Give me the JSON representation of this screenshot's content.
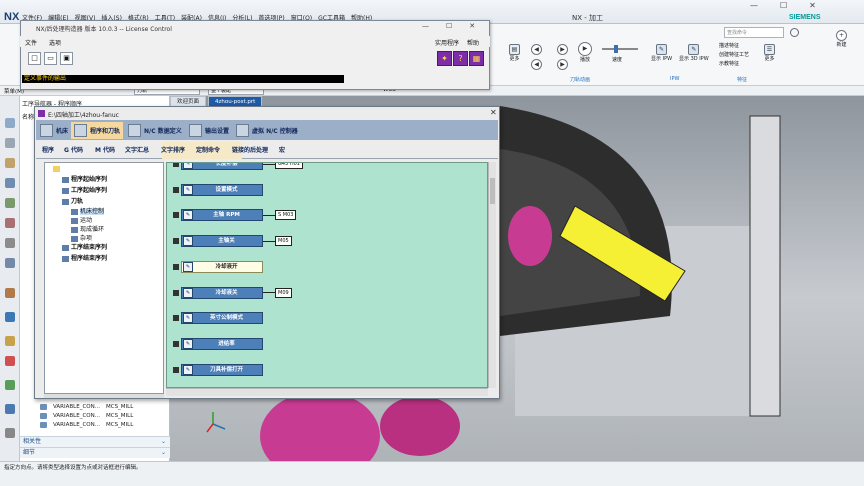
{
  "app": {
    "logo": "NX",
    "window_title": "NX - 加工",
    "brand": "SIEMENS",
    "menu": [
      "文件(F)",
      "编辑(E)",
      "视图(V)",
      "插入(S)",
      "格式(R)",
      "工具(T)",
      "装配(A)",
      "信息(I)",
      "分析(L)",
      "首选项(P)",
      "窗口(O)",
      "GC工具箱",
      "帮助(H)"
    ],
    "search_placeholder": "查找命令",
    "ribbon_groups": {
      "toolpath_anim": "刀轨动画",
      "ipw": "IPW",
      "features": "特征"
    },
    "ribbon_buttons": {
      "more1": "更多",
      "play": "播放",
      "speed": "速度",
      "show_ipw": "显示 IPW",
      "show_3d_ipw": "显示 3D IPW",
      "more2": "更多"
    },
    "ribbon_list": [
      "描述特征",
      "创建特征工艺",
      "示教特征"
    ],
    "right_actions": {
      "new": "新建"
    }
  },
  "toolbar": {
    "menu_btn": "菜单(M)",
    "filter_combo": "刀轨",
    "scope_combo": "整个装配",
    "wcs": "WCS"
  },
  "navigator": {
    "title": "工序导航器 - 程序顺序",
    "name_header": "名称",
    "rows": [
      {
        "name": "VARIABLE_CON...",
        "method": "MCS_MILL"
      },
      {
        "name": "VARIABLE_CON...",
        "method": "MCS_MILL"
      },
      {
        "name": "VARIABLE_CON...",
        "method": "MCS_MILL"
      }
    ],
    "panels": [
      "相关性",
      "细节"
    ]
  },
  "tabs": [
    "欢迎页面",
    "4zhou-post.prt"
  ],
  "status_text": "指定方向点。请将类型选择设置为点或对话框进行编辑。",
  "license_window": {
    "title": "NX/后处理构造器 版本 10.0.3 -- License Control",
    "menu": [
      "文件",
      "选项"
    ],
    "right_menu": [
      "实用程序",
      "帮助"
    ],
    "status": "定义事件的输出"
  },
  "post_builder": {
    "title": "E:\\四轴加工\\4zhou-fanuc",
    "main_tabs": [
      "机床",
      "程序和刀轨",
      "N/C 数据定义",
      "输出设置",
      "虚拟 N/C 控制器"
    ],
    "sub_tabs": [
      "程序",
      "G 代码",
      "M 代码",
      "文字汇总",
      "文字排序",
      "定制命令",
      "链接的后处理",
      "宏"
    ],
    "tree": {
      "n1": "程序起始序列",
      "n2": "工序起始序列",
      "n3": "刀轨",
      "n3a": "机床控制",
      "n3b": "运动",
      "n3c": "现成循环",
      "n3d": "杂项",
      "n4": "工序结束序列",
      "n5": "程序结束序列"
    },
    "blocks": [
      {
        "label": "长度补偿",
        "code": "G43 H01"
      },
      {
        "label": "设置模式",
        "code": ""
      },
      {
        "label": "主轴 RPM",
        "code": "S M03"
      },
      {
        "label": "主轴关",
        "code": "M05"
      },
      {
        "label": "冷却液开",
        "code": ""
      },
      {
        "label": "冷却液关",
        "code": "M09"
      },
      {
        "label": "英寸公制模式",
        "code": ""
      },
      {
        "label": "进给率",
        "code": ""
      },
      {
        "label": "刀具补偿打开",
        "code": ""
      }
    ]
  },
  "colors": {
    "nx_blue": "#1d5aa7",
    "tab_bar": "#9bb0c8",
    "canvas_green": "#aee4cf",
    "block_blue": "#4d7fb8",
    "siemens": "#009999"
  }
}
